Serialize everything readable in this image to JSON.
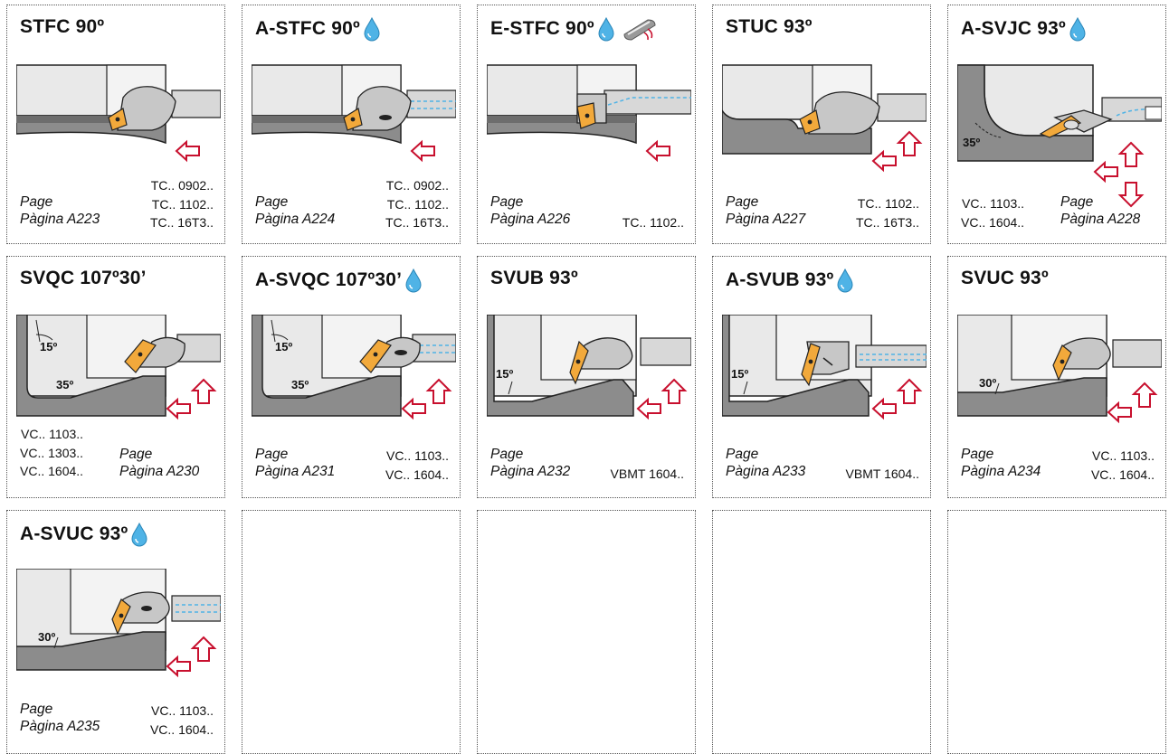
{
  "cells": [
    {
      "title": "STFC 90º",
      "coolant": false,
      "bar": false,
      "page": "Page",
      "pagina": "Pàgina A223",
      "codes": [
        "TC.. 0902..",
        "TC.. 1102..",
        "TC.. 16T3.."
      ],
      "angles": [],
      "arrows": [
        "left"
      ],
      "diagram": "stfc"
    },
    {
      "title": "A-STFC 90º",
      "coolant": true,
      "bar": false,
      "page": "Page",
      "pagina": "Pàgina A224",
      "codes": [
        "TC.. 0902..",
        "TC.. 1102..",
        "TC.. 16T3.."
      ],
      "angles": [],
      "arrows": [
        "left"
      ],
      "diagram": "stfc-coolant"
    },
    {
      "title": "E-STFC 90º",
      "coolant": true,
      "bar": true,
      "page": "Page",
      "pagina": "Pàgina A226",
      "codes": [
        "TC.. 1102.."
      ],
      "angles": [],
      "arrows": [
        "left"
      ],
      "diagram": "estfc"
    },
    {
      "title": "STUC 93º",
      "coolant": false,
      "bar": false,
      "page": "Page",
      "pagina": "Pàgina A227",
      "codes": [
        "TC.. 1102..",
        "TC.. 16T3.."
      ],
      "angles": [],
      "arrows": [
        "left",
        "up"
      ],
      "diagram": "stuc"
    },
    {
      "title": "A-SVJC 93º",
      "coolant": true,
      "bar": false,
      "page": "Page",
      "pagina": "Pàgina A228",
      "codes": [
        "VC.. 1103..",
        "VC.. 1604.."
      ],
      "angles": [
        "35º"
      ],
      "arrows": [
        "left",
        "up",
        "down"
      ],
      "diagram": "svjc"
    },
    {
      "title": "SVQC 107º30’",
      "coolant": false,
      "bar": false,
      "page": "Page",
      "pagina": "Pàgina A230",
      "codes": [
        "VC.. 1103..",
        "VC.. 1303..",
        "VC.. 1604.."
      ],
      "angles": [
        "15º",
        "35º"
      ],
      "arrows": [
        "left",
        "up"
      ],
      "diagram": "svqc"
    },
    {
      "title": "A-SVQC 107º30’",
      "coolant": true,
      "bar": false,
      "page": "Page",
      "pagina": "Pàgina A231",
      "codes": [
        "VC.. 1103..",
        "VC.. 1604.."
      ],
      "angles": [
        "15º",
        "35º"
      ],
      "arrows": [
        "left",
        "up"
      ],
      "diagram": "svqc-coolant"
    },
    {
      "title": "SVUB 93º",
      "coolant": false,
      "bar": false,
      "page": "Page",
      "pagina": "Pàgina A232",
      "codes": [
        "VBMT 1604.."
      ],
      "angles": [
        "15º"
      ],
      "arrows": [
        "left",
        "up"
      ],
      "diagram": "svub"
    },
    {
      "title": "A-SVUB 93º",
      "coolant": true,
      "bar": false,
      "page": "Page",
      "pagina": "Pàgina A233",
      "codes": [
        "VBMT 1604.."
      ],
      "angles": [
        "15º"
      ],
      "arrows": [
        "left",
        "up"
      ],
      "diagram": "asvub"
    },
    {
      "title": "SVUC 93º",
      "coolant": false,
      "bar": false,
      "page": "Page",
      "pagina": "Pàgina A234",
      "codes": [
        "VC.. 1103..",
        "VC.. 1604.."
      ],
      "angles": [
        "30º"
      ],
      "arrows": [
        "left",
        "up"
      ],
      "diagram": "svuc"
    },
    {
      "title": "A-SVUC 93º",
      "coolant": true,
      "bar": false,
      "page": "Page",
      "pagina": "Pàgina A235",
      "codes": [
        "VC.. 1103..",
        "VC.. 1604.."
      ],
      "angles": [
        "30º"
      ],
      "arrows": [
        "left",
        "up"
      ],
      "diagram": "svuc-coolant"
    }
  ],
  "colors": {
    "insert": "#f2a93b",
    "workpiece": "#8c8c8c",
    "body": "#c7c7c7",
    "arrow": "#c8102e",
    "coolant": "#4fb3e6",
    "line": "#222222"
  }
}
